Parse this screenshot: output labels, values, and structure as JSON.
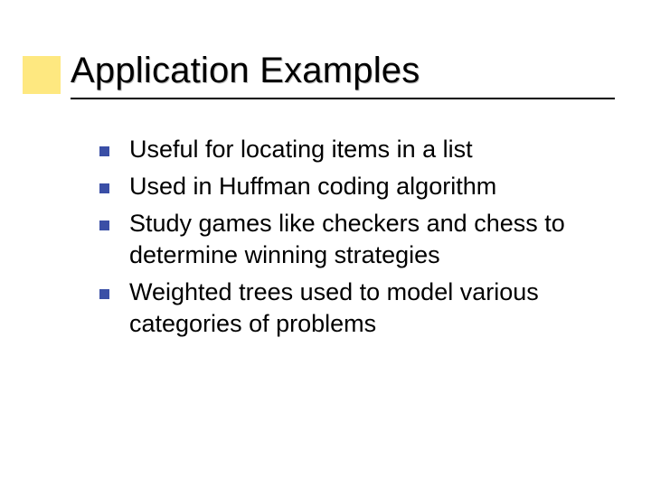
{
  "slide": {
    "title": "Application Examples",
    "bullets": [
      {
        "text": "Useful for locating items in a list"
      },
      {
        "text": "Used in Huffman coding algorithm"
      },
      {
        "text": "Study games like checkers and chess to determine winning strategies"
      },
      {
        "text": "Weighted trees used to model various categories of problems"
      }
    ]
  }
}
